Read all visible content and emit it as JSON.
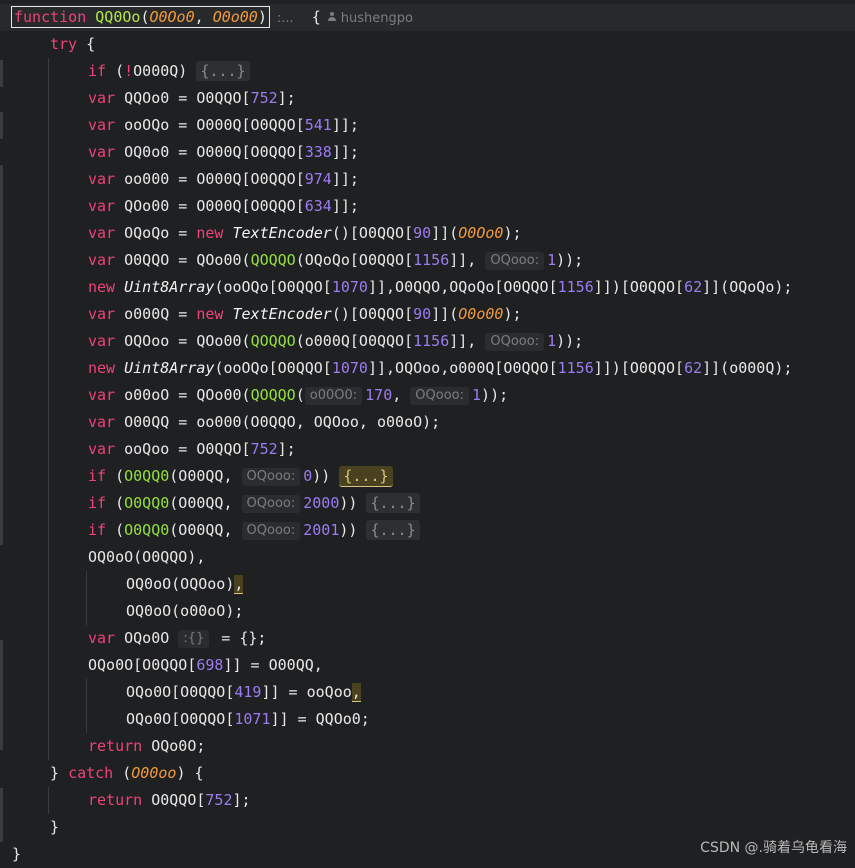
{
  "editor": {
    "author_hint": "hushengpo",
    "signature_extra": ":...",
    "lines": [
      [
        [
          "kw",
          "function"
        ],
        [
          "p",
          " "
        ],
        [
          "fn",
          "QQ0Oo"
        ],
        [
          "p",
          "("
        ],
        [
          "param",
          "O0Oo0"
        ],
        [
          "p",
          ", "
        ],
        [
          "param",
          "O0o00"
        ],
        [
          "p",
          ")"
        ]
      ],
      [
        [
          "kw",
          "try"
        ],
        [
          "p",
          " {"
        ]
      ],
      [
        [
          "kw",
          "if"
        ],
        [
          "p",
          " ("
        ],
        [
          "kw",
          "!"
        ],
        [
          "p",
          "O000Q) "
        ],
        [
          "fold",
          "{...}"
        ]
      ],
      [
        [
          "kw",
          "var"
        ],
        [
          "p",
          " QQOo0 = O0QQO["
        ],
        [
          "num",
          "752"
        ],
        [
          "p",
          "];"
        ]
      ],
      [
        [
          "kw",
          "var"
        ],
        [
          "p",
          " ooOQo = O000Q[O0QQO["
        ],
        [
          "num",
          "541"
        ],
        [
          "p",
          "]];"
        ]
      ],
      [
        [
          "kw",
          "var"
        ],
        [
          "p",
          " OQ0o0 = O000Q[O0QQO["
        ],
        [
          "num",
          "338"
        ],
        [
          "p",
          "]];"
        ]
      ],
      [
        [
          "kw",
          "var"
        ],
        [
          "p",
          " oo000 = O000Q[O0QQO["
        ],
        [
          "num",
          "974"
        ],
        [
          "p",
          "]];"
        ]
      ],
      [
        [
          "kw",
          "var"
        ],
        [
          "p",
          " QOo00 = O000Q[O0QQO["
        ],
        [
          "num",
          "634"
        ],
        [
          "p",
          "]];"
        ]
      ],
      [
        [
          "kw",
          "var"
        ],
        [
          "p",
          " OQoQo = "
        ],
        [
          "kw",
          "new"
        ],
        [
          "p",
          " "
        ],
        [
          "cls",
          "TextEncoder"
        ],
        [
          "p",
          "()[O0QQO["
        ],
        [
          "num",
          "90"
        ],
        [
          "p",
          "]]("
        ],
        [
          "param",
          "O0Oo0"
        ],
        [
          "p",
          ");"
        ]
      ],
      [
        [
          "kw",
          "var"
        ],
        [
          "p",
          " O0QQO = QOo00("
        ],
        [
          "call",
          "QOQQO"
        ],
        [
          "p",
          "(OQoQo[O0QQO["
        ],
        [
          "num",
          "1156"
        ],
        [
          "p",
          "]], "
        ],
        [
          "hint",
          "OQooo:"
        ],
        [
          "num",
          "1"
        ],
        [
          "p",
          "));"
        ]
      ],
      [
        [
          "kw",
          "new"
        ],
        [
          "p",
          " "
        ],
        [
          "cls",
          "Uint8Array"
        ],
        [
          "p",
          "(ooOQo[O0QQO["
        ],
        [
          "num",
          "1070"
        ],
        [
          "p",
          "]],O0QQO,OQoQo[O0QQO["
        ],
        [
          "num",
          "1156"
        ],
        [
          "p",
          "]])[O0QQO["
        ],
        [
          "num",
          "62"
        ],
        [
          "p",
          "]](OQoQo);"
        ]
      ],
      [
        [
          "kw",
          "var"
        ],
        [
          "p",
          " o000Q = "
        ],
        [
          "kw",
          "new"
        ],
        [
          "p",
          " "
        ],
        [
          "cls",
          "TextEncoder"
        ],
        [
          "p",
          "()[O0QQO["
        ],
        [
          "num",
          "90"
        ],
        [
          "p",
          "]]("
        ],
        [
          "param",
          "O0o00"
        ],
        [
          "p",
          ");"
        ]
      ],
      [
        [
          "kw",
          "var"
        ],
        [
          "p",
          " OQOoo = QOo00("
        ],
        [
          "call",
          "QOQQO"
        ],
        [
          "p",
          "(o000Q[O0QQO["
        ],
        [
          "num",
          "1156"
        ],
        [
          "p",
          "]], "
        ],
        [
          "hint",
          "OQooo:"
        ],
        [
          "num",
          "1"
        ],
        [
          "p",
          "));"
        ]
      ],
      [
        [
          "kw",
          "new"
        ],
        [
          "p",
          " "
        ],
        [
          "cls",
          "Uint8Array"
        ],
        [
          "p",
          "(ooOQo[O0QQO["
        ],
        [
          "num",
          "1070"
        ],
        [
          "p",
          "]],OQOoo,o000Q[O0QQO["
        ],
        [
          "num",
          "1156"
        ],
        [
          "p",
          "]])[O0QQO["
        ],
        [
          "num",
          "62"
        ],
        [
          "p",
          "]](o000Q);"
        ]
      ],
      [
        [
          "kw",
          "var"
        ],
        [
          "p",
          " o00oO = QOo00("
        ],
        [
          "call",
          "QOQQO"
        ],
        [
          "p",
          "("
        ],
        [
          "hint",
          "o00O0:"
        ],
        [
          "num",
          "170"
        ],
        [
          "p",
          ", "
        ],
        [
          "hint",
          "OQooo:"
        ],
        [
          "num",
          "1"
        ],
        [
          "p",
          "));"
        ]
      ],
      [
        [
          "kw",
          "var"
        ],
        [
          "p",
          " O00QQ = oo000(O0QQO, OQOoo, o00oO);"
        ]
      ],
      [
        [
          "kw",
          "var"
        ],
        [
          "p",
          " ooQoo = O0QQO["
        ],
        [
          "num",
          "752"
        ],
        [
          "p",
          "];"
        ]
      ],
      [
        [
          "kw",
          "if"
        ],
        [
          "p",
          " ("
        ],
        [
          "call",
          "O0QQ0"
        ],
        [
          "p",
          "(O00QQ, "
        ],
        [
          "hint",
          "OQooo:"
        ],
        [
          "num",
          "0"
        ],
        [
          "p",
          ")) "
        ],
        [
          "foldhl",
          "{...}"
        ]
      ],
      [
        [
          "kw",
          "if"
        ],
        [
          "p",
          " ("
        ],
        [
          "call",
          "O0QQ0"
        ],
        [
          "p",
          "(O00QQ, "
        ],
        [
          "hint",
          "OQooo:"
        ],
        [
          "num",
          "2000"
        ],
        [
          "p",
          ")) "
        ],
        [
          "fold",
          "{...}"
        ]
      ],
      [
        [
          "kw",
          "if"
        ],
        [
          "p",
          " ("
        ],
        [
          "call",
          "O0QQ0"
        ],
        [
          "p",
          "(O00QQ, "
        ],
        [
          "hint",
          "OQooo:"
        ],
        [
          "num",
          "2001"
        ],
        [
          "p",
          ")) "
        ],
        [
          "fold",
          "{...}"
        ]
      ],
      [
        [
          "p",
          "OQ0oO(O0QQO),"
        ]
      ],
      [
        [
          "p",
          "OQ0oO(OQOoo)"
        ],
        [
          "match",
          ","
        ]
      ],
      [
        [
          "p",
          "OQ0oO(o00oO);"
        ]
      ],
      [
        [
          "kw",
          "var"
        ],
        [
          "p",
          " OQo0O "
        ],
        [
          "hint",
          ":{}"
        ],
        [
          "p",
          " = {};"
        ]
      ],
      [
        [
          "p",
          "OQo0O[O0QQO["
        ],
        [
          "num",
          "698"
        ],
        [
          "p",
          "]] = O00QQ,"
        ]
      ],
      [
        [
          "p",
          "OQo0O[O0QQO["
        ],
        [
          "num",
          "419"
        ],
        [
          "p",
          "]] = ooQoo"
        ],
        [
          "match",
          ","
        ]
      ],
      [
        [
          "p",
          "OQo0O[O0QQO["
        ],
        [
          "num",
          "1071"
        ],
        [
          "p",
          "]] = QQOo0;"
        ]
      ],
      [
        [
          "kw",
          "return"
        ],
        [
          "p",
          " OQo0O;"
        ]
      ],
      [
        [
          "p",
          "} "
        ],
        [
          "kw",
          "catch"
        ],
        [
          "p",
          " ("
        ],
        [
          "param",
          "O00oo"
        ],
        [
          "p",
          ") {"
        ]
      ],
      [
        [
          "kw",
          "return"
        ],
        [
          "p",
          " O0QQO["
        ],
        [
          "num",
          "752"
        ],
        [
          "p",
          "];"
        ]
      ],
      [
        [
          "p",
          "}"
        ]
      ],
      [
        [
          "p",
          "}"
        ]
      ]
    ]
  },
  "watermark": "CSDN @.骑着乌龟看海"
}
